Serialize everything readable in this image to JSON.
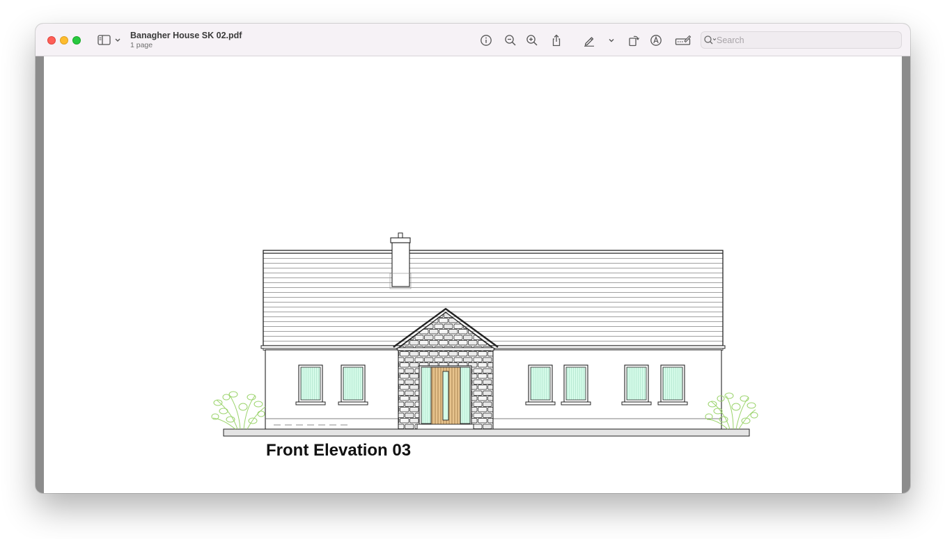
{
  "window": {
    "document_title": "Banagher House SK 02.pdf",
    "page_count": "1 page"
  },
  "toolbar": {
    "icons": [
      "sidebar-icon",
      "info-icon",
      "zoom-out-icon",
      "zoom-in-icon",
      "share-icon",
      "markup-pen-icon",
      "rotate-icon",
      "annotate-icon",
      "form-fill-icon"
    ],
    "search_placeholder": "Search"
  },
  "document": {
    "caption": "Front Elevation 03"
  },
  "colors": {
    "close": "#fe5f57",
    "minimize": "#febc2e",
    "maximize": "#28c840",
    "glazing": "#d5fbe9",
    "timber_door": "#e8c48e",
    "planting": "#9ad36a"
  }
}
